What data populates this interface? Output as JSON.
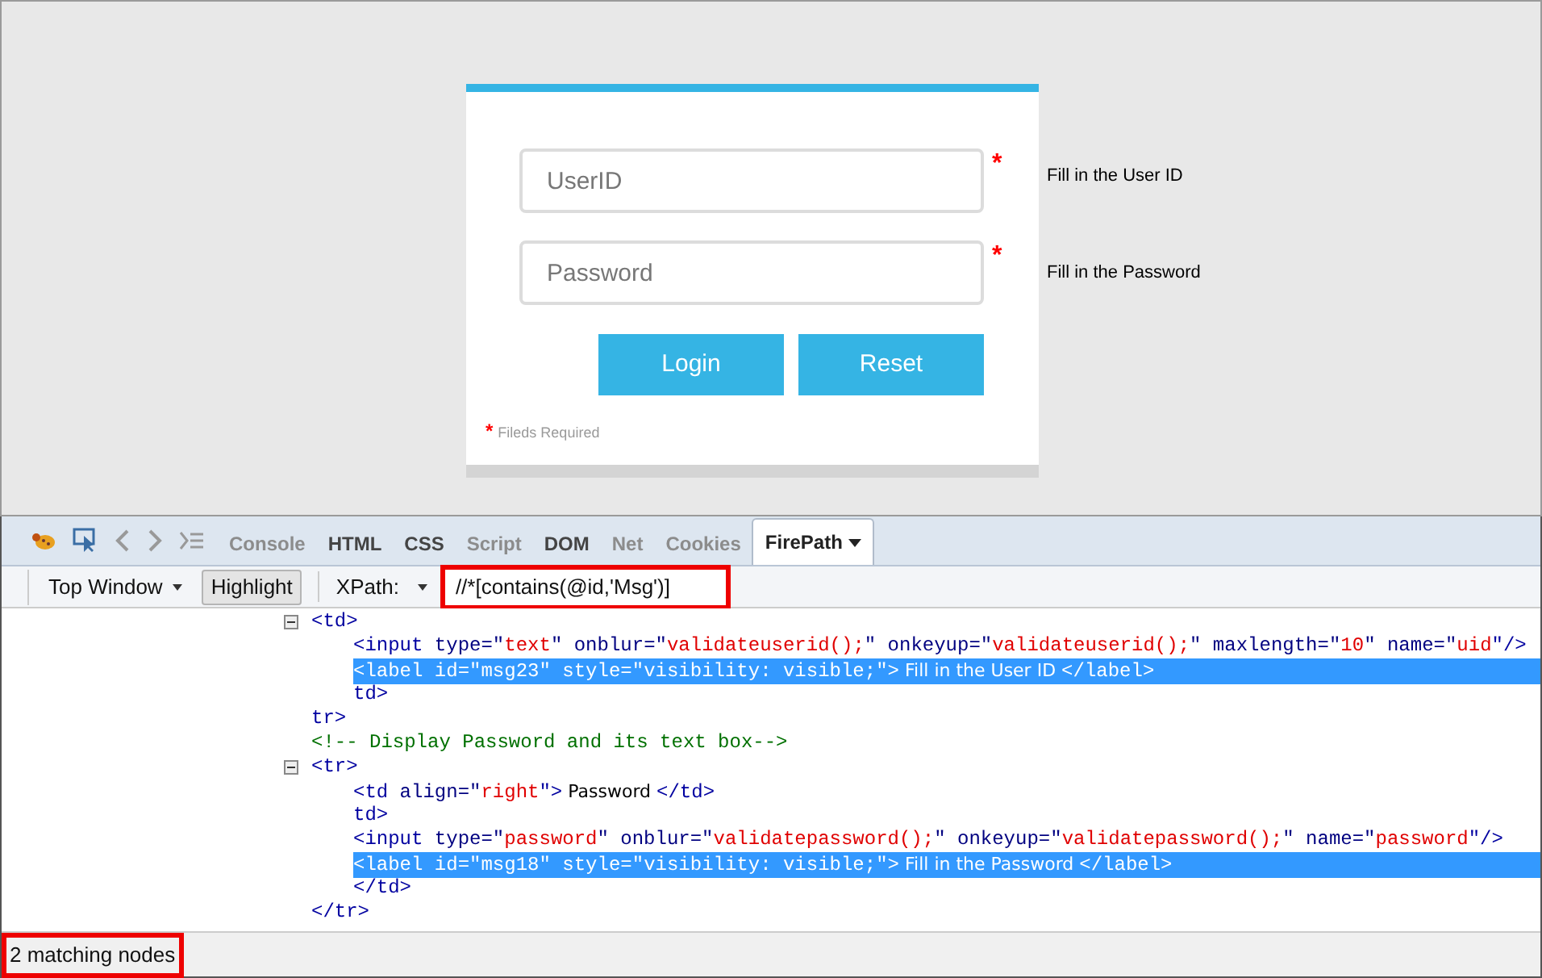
{
  "login_form": {
    "fields": [
      {
        "placeholder": "UserID",
        "required_mark": "*",
        "message": "Fill in the User ID"
      },
      {
        "placeholder": "Password",
        "required_mark": "*",
        "message": "Fill in the Password"
      }
    ],
    "buttons": [
      "Login",
      "Reset"
    ],
    "footnote": {
      "mark": "*",
      "text": "Fileds Required"
    }
  },
  "devtools": {
    "tabs": [
      {
        "label": "Console",
        "disabled": true,
        "selected": false
      },
      {
        "label": "HTML",
        "disabled": false,
        "selected": false
      },
      {
        "label": "CSS",
        "disabled": false,
        "selected": false
      },
      {
        "label": "Script",
        "disabled": true,
        "selected": false
      },
      {
        "label": "DOM",
        "disabled": false,
        "selected": false
      },
      {
        "label": "Net",
        "disabled": true,
        "selected": false
      },
      {
        "label": "Cookies",
        "disabled": true,
        "selected": false
      },
      {
        "label": "FirePath",
        "disabled": false,
        "selected": true
      }
    ],
    "toolbar": {
      "frame_select": "Top Window",
      "highlight_button": "Highlight",
      "xpath_label": "XPath:",
      "xpath_value": "//*[contains(@id,'Msg')]"
    },
    "tree": [
      {
        "expanded": true,
        "selected": false,
        "segments": [
          {
            "kind": "tag",
            "text": "<td>"
          }
        ],
        "children": [
          {
            "selected": false,
            "segments": [
              {
                "kind": "tag",
                "text": "<input"
              },
              {
                "kind": "attr",
                "text": " type=\""
              },
              {
                "kind": "value",
                "text": "text"
              },
              {
                "kind": "attr",
                "text": "\" onblur=\""
              },
              {
                "kind": "value",
                "text": "validateuserid();"
              },
              {
                "kind": "attr",
                "text": "\" onkeyup=\""
              },
              {
                "kind": "value",
                "text": "validateuserid();"
              },
              {
                "kind": "attr",
                "text": "\" maxlength=\""
              },
              {
                "kind": "value",
                "text": "10"
              },
              {
                "kind": "attr",
                "text": "\" name=\""
              },
              {
                "kind": "value",
                "text": "uid"
              },
              {
                "kind": "tag",
                "text": "\"/>"
              }
            ]
          },
          {
            "selected": true,
            "segments": [
              {
                "kind": "tag",
                "text": "<label"
              },
              {
                "kind": "attr",
                "text": " id=\""
              },
              {
                "kind": "value",
                "text": "msg23"
              },
              {
                "kind": "attr",
                "text": "\" style=\""
              },
              {
                "kind": "value",
                "text": "visibility: visible;"
              },
              {
                "kind": "tag",
                "text": "\">"
              },
              {
                "kind": "text",
                "text": " Fill in the User ID "
              },
              {
                "kind": "tag",
                "text": "</label>"
              }
            ]
          },
          {
            "selected": false,
            "segments": [
              {
                "kind": "tag",
                "text": "td>"
              }
            ]
          }
        ]
      },
      {
        "selected": false,
        "segments": [
          {
            "kind": "tag",
            "text": "tr>"
          }
        ]
      },
      {
        "selected": false,
        "segments": [
          {
            "kind": "comment",
            "text": "<!-- Display Password and its text box-->"
          }
        ]
      },
      {
        "expanded": true,
        "selected": false,
        "segments": [
          {
            "kind": "tag",
            "text": "<tr>"
          }
        ],
        "children": [
          {
            "selected": false,
            "segments": [
              {
                "kind": "tag",
                "text": "<td"
              },
              {
                "kind": "attr",
                "text": " align=\""
              },
              {
                "kind": "value",
                "text": "right"
              },
              {
                "kind": "tag",
                "text": "\">"
              },
              {
                "kind": "text",
                "text": " Password "
              },
              {
                "kind": "tag",
                "text": "</td>"
              }
            ]
          },
          {
            "selected": false,
            "segments": [
              {
                "kind": "tag",
                "text": "td>"
              }
            ]
          },
          {
            "selected": false,
            "segments": [
              {
                "kind": "tag",
                "text": "<input"
              },
              {
                "kind": "attr",
                "text": " type=\""
              },
              {
                "kind": "value",
                "text": "password"
              },
              {
                "kind": "attr",
                "text": "\" onblur=\""
              },
              {
                "kind": "value",
                "text": "validatepassword();"
              },
              {
                "kind": "attr",
                "text": "\" onkeyup=\""
              },
              {
                "kind": "value",
                "text": "validatepassword();"
              },
              {
                "kind": "attr",
                "text": "\" name=\""
              },
              {
                "kind": "value",
                "text": "password"
              },
              {
                "kind": "tag",
                "text": "\"/>"
              }
            ]
          },
          {
            "selected": true,
            "segments": [
              {
                "kind": "tag",
                "text": "<label"
              },
              {
                "kind": "attr",
                "text": " id=\""
              },
              {
                "kind": "value",
                "text": "msg18"
              },
              {
                "kind": "attr",
                "text": "\" style=\""
              },
              {
                "kind": "value",
                "text": "visibility: visible;"
              },
              {
                "kind": "tag",
                "text": "\">"
              },
              {
                "kind": "text",
                "text": " Fill in the Password "
              },
              {
                "kind": "tag",
                "text": "</label>"
              }
            ]
          },
          {
            "selected": false,
            "segments": [
              {
                "kind": "tag",
                "text": "</td>"
              }
            ]
          }
        ]
      },
      {
        "selected": false,
        "segments": [
          {
            "kind": "tag",
            "text": "</tr>"
          }
        ]
      }
    ],
    "status_bar": "2 matching nodes"
  }
}
